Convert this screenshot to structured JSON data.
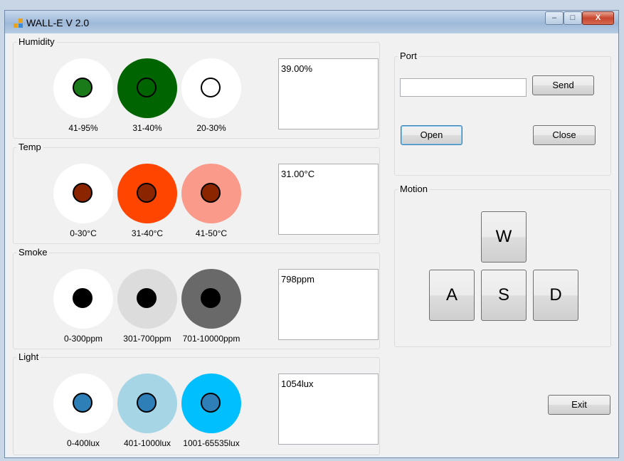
{
  "window": {
    "title": "WALL-E V 2.0",
    "minimize": "–",
    "maximize": "□",
    "close": "X"
  },
  "sensors": [
    {
      "name": "Humidity",
      "reading": "39.00%",
      "levels": [
        {
          "label": "41-95%",
          "color": "#ffffff",
          "dot": "#1a7a1a"
        },
        {
          "label": "31-40%",
          "color": "#006400",
          "dot": "#006400"
        },
        {
          "label": "20-30%",
          "color": "#ffffff",
          "dot": "#ffffff"
        }
      ]
    },
    {
      "name": "Temp",
      "reading": "31.00°C",
      "levels": [
        {
          "label": "0-30°C",
          "color": "#ffffff",
          "dot": "#8b2500"
        },
        {
          "label": "31-40°C",
          "color": "#ff4500",
          "dot": "#8b2500"
        },
        {
          "label": "41-50°C",
          "color": "#fa9a8a",
          "dot": "#8b2500"
        }
      ]
    },
    {
      "name": "Smoke",
      "reading": "798ppm",
      "levels": [
        {
          "label": "0-300ppm",
          "color": "#ffffff",
          "dot": "#000000"
        },
        {
          "label": "301-700ppm",
          "color": "#dcdcdc",
          "dot": "#000000"
        },
        {
          "label": "701-10000ppm",
          "color": "#696969",
          "dot": "#000000"
        }
      ]
    },
    {
      "name": "Light",
      "reading": "1054lux",
      "levels": [
        {
          "label": "0-400lux",
          "color": "#ffffff",
          "dot": "#2e7fb8"
        },
        {
          "label": "401-1000lux",
          "color": "#a6d5e6",
          "dot": "#2e7fb8"
        },
        {
          "label": "1001-65535lux",
          "color": "#00bfff",
          "dot": "#2e7fb8"
        }
      ]
    }
  ],
  "port": {
    "label": "Port",
    "input_value": "",
    "send": "Send",
    "open": "Open",
    "close": "Close"
  },
  "motion": {
    "label": "Motion",
    "up": "W",
    "left": "A",
    "down": "S",
    "right": "D"
  },
  "exit": "Exit"
}
